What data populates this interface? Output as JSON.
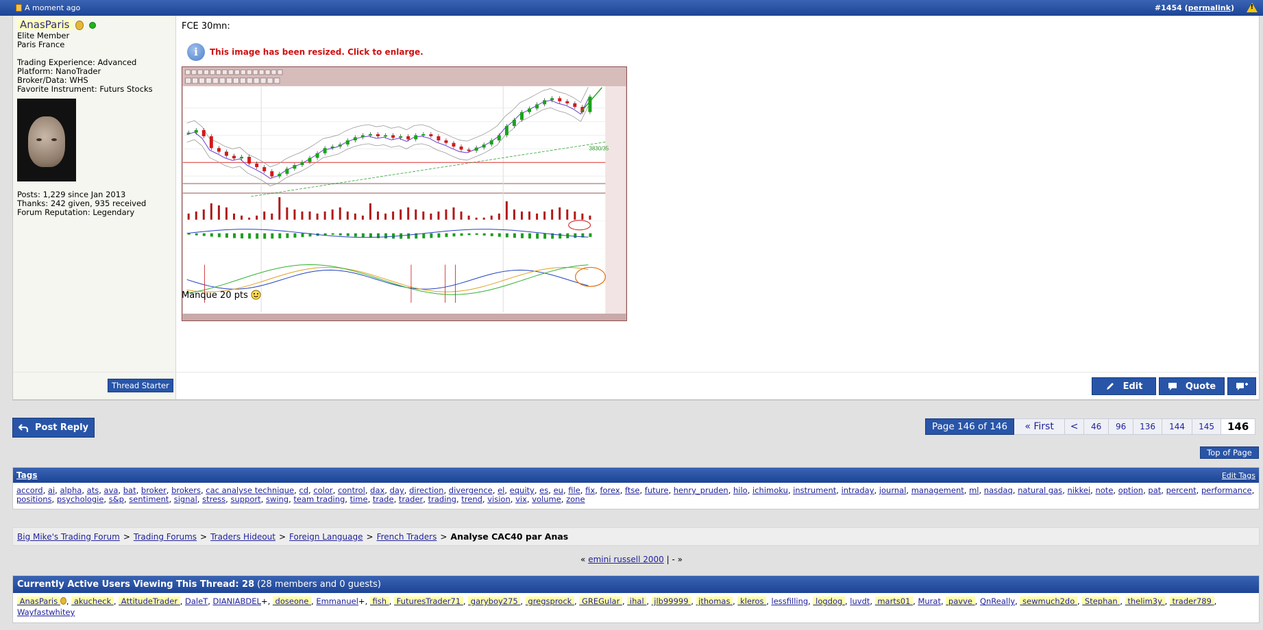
{
  "post": {
    "time": "A moment ago",
    "number": "#1454",
    "permalink": "permalink",
    "user": {
      "name": "AnasParis",
      "rank": "Elite Member",
      "location": "Paris France",
      "trading_experience": "Trading Experience: Advanced",
      "platform": "Platform: NanoTrader",
      "broker": "Broker/Data: WHS",
      "favorite": "Favorite Instrument: Futurs Stocks",
      "posts": "Posts: 1,229 since Jan 2013",
      "thanks": "Thanks: 242 given, 935 received",
      "reputation": "Forum Reputation: Legendary",
      "badge": "Thread Starter"
    },
    "title_line": "FCE 30mn:",
    "resize_note": "This image has been resized.  Click to enlarge.",
    "footer_text": "Manque 20 pts",
    "buttons": {
      "edit": "Edit",
      "quote": "Quote"
    }
  },
  "chart_data": {
    "type": "candlestick",
    "annotation": "3830/35",
    "closes": [
      3775,
      3780,
      3768,
      3745,
      3738,
      3730,
      3725,
      3728,
      3715,
      3708,
      3700,
      3690,
      3695,
      3705,
      3712,
      3718,
      3726,
      3735,
      3745,
      3748,
      3752,
      3760,
      3766,
      3770,
      3772,
      3768,
      3770,
      3765,
      3768,
      3762,
      3770,
      3772,
      3768,
      3760,
      3755,
      3748,
      3742,
      3740,
      3746,
      3752,
      3760,
      3770,
      3788,
      3800,
      3815,
      3822,
      3830,
      3838,
      3842,
      3836,
      3832,
      3825,
      3815,
      3845
    ],
    "volume": [
      3,
      4,
      5,
      8,
      7,
      6,
      3,
      2,
      1,
      2,
      4,
      3,
      11,
      6,
      5,
      4,
      4,
      3,
      4,
      5,
      6,
      4,
      3,
      2,
      8,
      4,
      3,
      4,
      5,
      6,
      5,
      4,
      3,
      4,
      5,
      6,
      4,
      2,
      1,
      1,
      2,
      3,
      9,
      5,
      4,
      4,
      3,
      4,
      5,
      6,
      5,
      4,
      3,
      2
    ]
  },
  "pagination": {
    "info": "Page 146 of 146",
    "first": "« First",
    "prev": "<",
    "pages": [
      "46",
      "96",
      "136",
      "144",
      "145"
    ],
    "current": "146"
  },
  "post_reply": "Post Reply",
  "top_of_page": "Top of Page",
  "tags": {
    "title": "Tags",
    "edit": "Edit Tags",
    "items": [
      "accord",
      "ai",
      "alpha",
      "ats",
      "ava",
      "bat",
      "broker",
      "brokers",
      "cac analyse technique",
      "cd",
      "color",
      "control",
      "dax",
      "day",
      "direction",
      "divergence",
      "el",
      "equity",
      "es",
      "eu",
      "file",
      "fix",
      "forex",
      "ftse",
      "future",
      "henry_pruden",
      "hilo",
      "ichimoku",
      "instrument",
      "intraday",
      "journal",
      "management",
      "ml",
      "nasdaq",
      "natural gas",
      "nikkei",
      "note",
      "option",
      "pat",
      "percent",
      "performance",
      "positions",
      "psychologie",
      "s&p",
      "sentiment",
      "signal",
      "stress",
      "support",
      "swing",
      "team trading",
      "time",
      "trade",
      "trader",
      "trading",
      "trend",
      "vision",
      "vix",
      "volume",
      "zone"
    ]
  },
  "breadcrumb": {
    "items": [
      "Big Mike's Trading Forum",
      "Trading Forums",
      "Traders Hideout",
      "Foreign Language",
      "French Traders"
    ],
    "current": "Analyse CAC40 par Anas"
  },
  "prevnext": {
    "left": "«",
    "prev_thread": "emini russell 2000",
    "sep": "| -",
    "right": "»"
  },
  "active_users": {
    "title": "Currently Active Users Viewing This Thread: 28",
    "subtitle": "(28 members and 0 guests)",
    "users": [
      {
        "name": "AnasParis",
        "hl": true,
        "plus": false
      },
      {
        "name": "akucheck",
        "hl": true,
        "plus": false
      },
      {
        "name": "AttitudeTrader",
        "hl": true,
        "plus": false
      },
      {
        "name": "DaleT",
        "hl": false,
        "plus": false
      },
      {
        "name": "DIANIABDEL",
        "hl": false,
        "plus": true
      },
      {
        "name": "doseone",
        "hl": true,
        "plus": false
      },
      {
        "name": "Emmanuel",
        "hl": false,
        "plus": true
      },
      {
        "name": "fish",
        "hl": true,
        "plus": false
      },
      {
        "name": "FuturesTrader71",
        "hl": true,
        "plus": false
      },
      {
        "name": "garyboy275",
        "hl": true,
        "plus": false
      },
      {
        "name": "gregsprock",
        "hl": true,
        "plus": false
      },
      {
        "name": "GREGular",
        "hl": true,
        "plus": false
      },
      {
        "name": "ihal",
        "hl": true,
        "plus": false
      },
      {
        "name": "jlb99999",
        "hl": true,
        "plus": false
      },
      {
        "name": "jthomas",
        "hl": true,
        "plus": false
      },
      {
        "name": "kleros",
        "hl": true,
        "plus": false
      },
      {
        "name": "lessfilling",
        "hl": false,
        "plus": false
      },
      {
        "name": "logdog",
        "hl": true,
        "plus": false
      },
      {
        "name": "luvdt",
        "hl": false,
        "plus": false
      },
      {
        "name": "marts01",
        "hl": true,
        "plus": false
      },
      {
        "name": "Murat",
        "hl": false,
        "plus": false
      },
      {
        "name": "pavve",
        "hl": true,
        "plus": false
      },
      {
        "name": "QnReally",
        "hl": false,
        "plus": false
      },
      {
        "name": "sewmuch2do",
        "hl": true,
        "plus": false
      },
      {
        "name": "Stephan",
        "hl": true,
        "plus": false
      },
      {
        "name": "thelim3y",
        "hl": true,
        "plus": false
      },
      {
        "name": "trader789",
        "hl": true,
        "plus": false
      },
      {
        "name": "Wayfastwhitey",
        "hl": false,
        "plus": false
      }
    ]
  },
  "colors": {
    "header_blue": "#1d4496",
    "button_blue": "#2855a8",
    "highlight": "#ffffa8"
  }
}
